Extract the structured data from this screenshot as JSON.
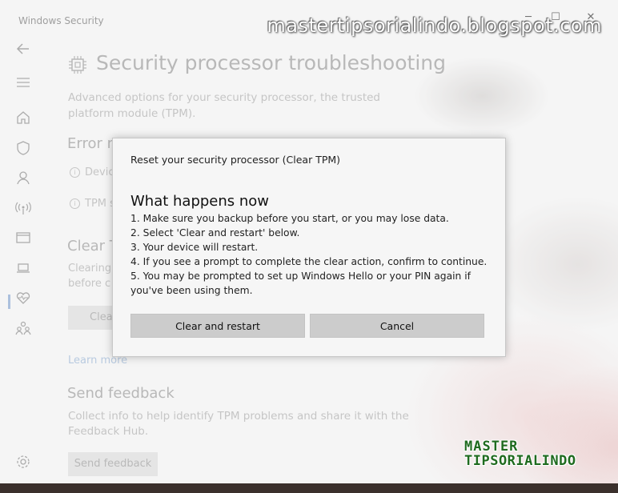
{
  "window": {
    "app_title": "Windows Security",
    "controls": {
      "minimize": "─",
      "maximize": "☐",
      "close": "✕"
    }
  },
  "watermark": {
    "top_text": "mastertipsorialindo.blogspot.com",
    "brand_line1": "MASTER",
    "brand_line2": "TIPSORIALINDO"
  },
  "sidebar": {
    "items": [
      {
        "icon": "back-arrow-icon"
      },
      {
        "icon": "hamburger-menu-icon"
      },
      {
        "icon": "home-icon"
      },
      {
        "icon": "shield-icon"
      },
      {
        "icon": "person-icon"
      },
      {
        "icon": "wifi-antenna-icon"
      },
      {
        "icon": "app-browser-icon"
      },
      {
        "icon": "laptop-icon",
        "active": true
      },
      {
        "icon": "heart-icon"
      },
      {
        "icon": "family-icon"
      },
      {
        "icon": "settings-gear-icon"
      }
    ]
  },
  "page": {
    "title": "Security processor troubleshooting",
    "description": "Advanced options for your security processor, the trusted platform module (TPM).",
    "error_heading": "Error m",
    "info_row_1": "Device",
    "info_row_2": "TPM s",
    "clear_heading": "Clear T",
    "clear_desc_line1": "Clearing",
    "clear_desc_line2": "before c",
    "clear_button_partial": "Clea",
    "learn_more": "Learn more",
    "feedback_heading": "Send feedback",
    "feedback_desc": "Collect info to help identify TPM problems and share it with the Feedback Hub.",
    "feedback_button": "Send feedback"
  },
  "dialog": {
    "title": "Reset your security processor (Clear TPM)",
    "heading": "What happens now",
    "steps": [
      "1. Make sure you backup before you start, or you may lose data.",
      "2. Select 'Clear and restart' below.",
      "3. Your device will restart.",
      "4. If you see a prompt to complete the clear action, confirm to continue.",
      "5. You may be prompted to set up Windows Hello or your PIN again if you've been using them."
    ],
    "primary_button": "Clear and restart",
    "cancel_button": "Cancel"
  },
  "colors": {
    "dialog_bg": "#f6f6f6",
    "button_bg": "#cccccc",
    "link": "#a9bfd9",
    "brand_green": "#1f6b1f"
  }
}
